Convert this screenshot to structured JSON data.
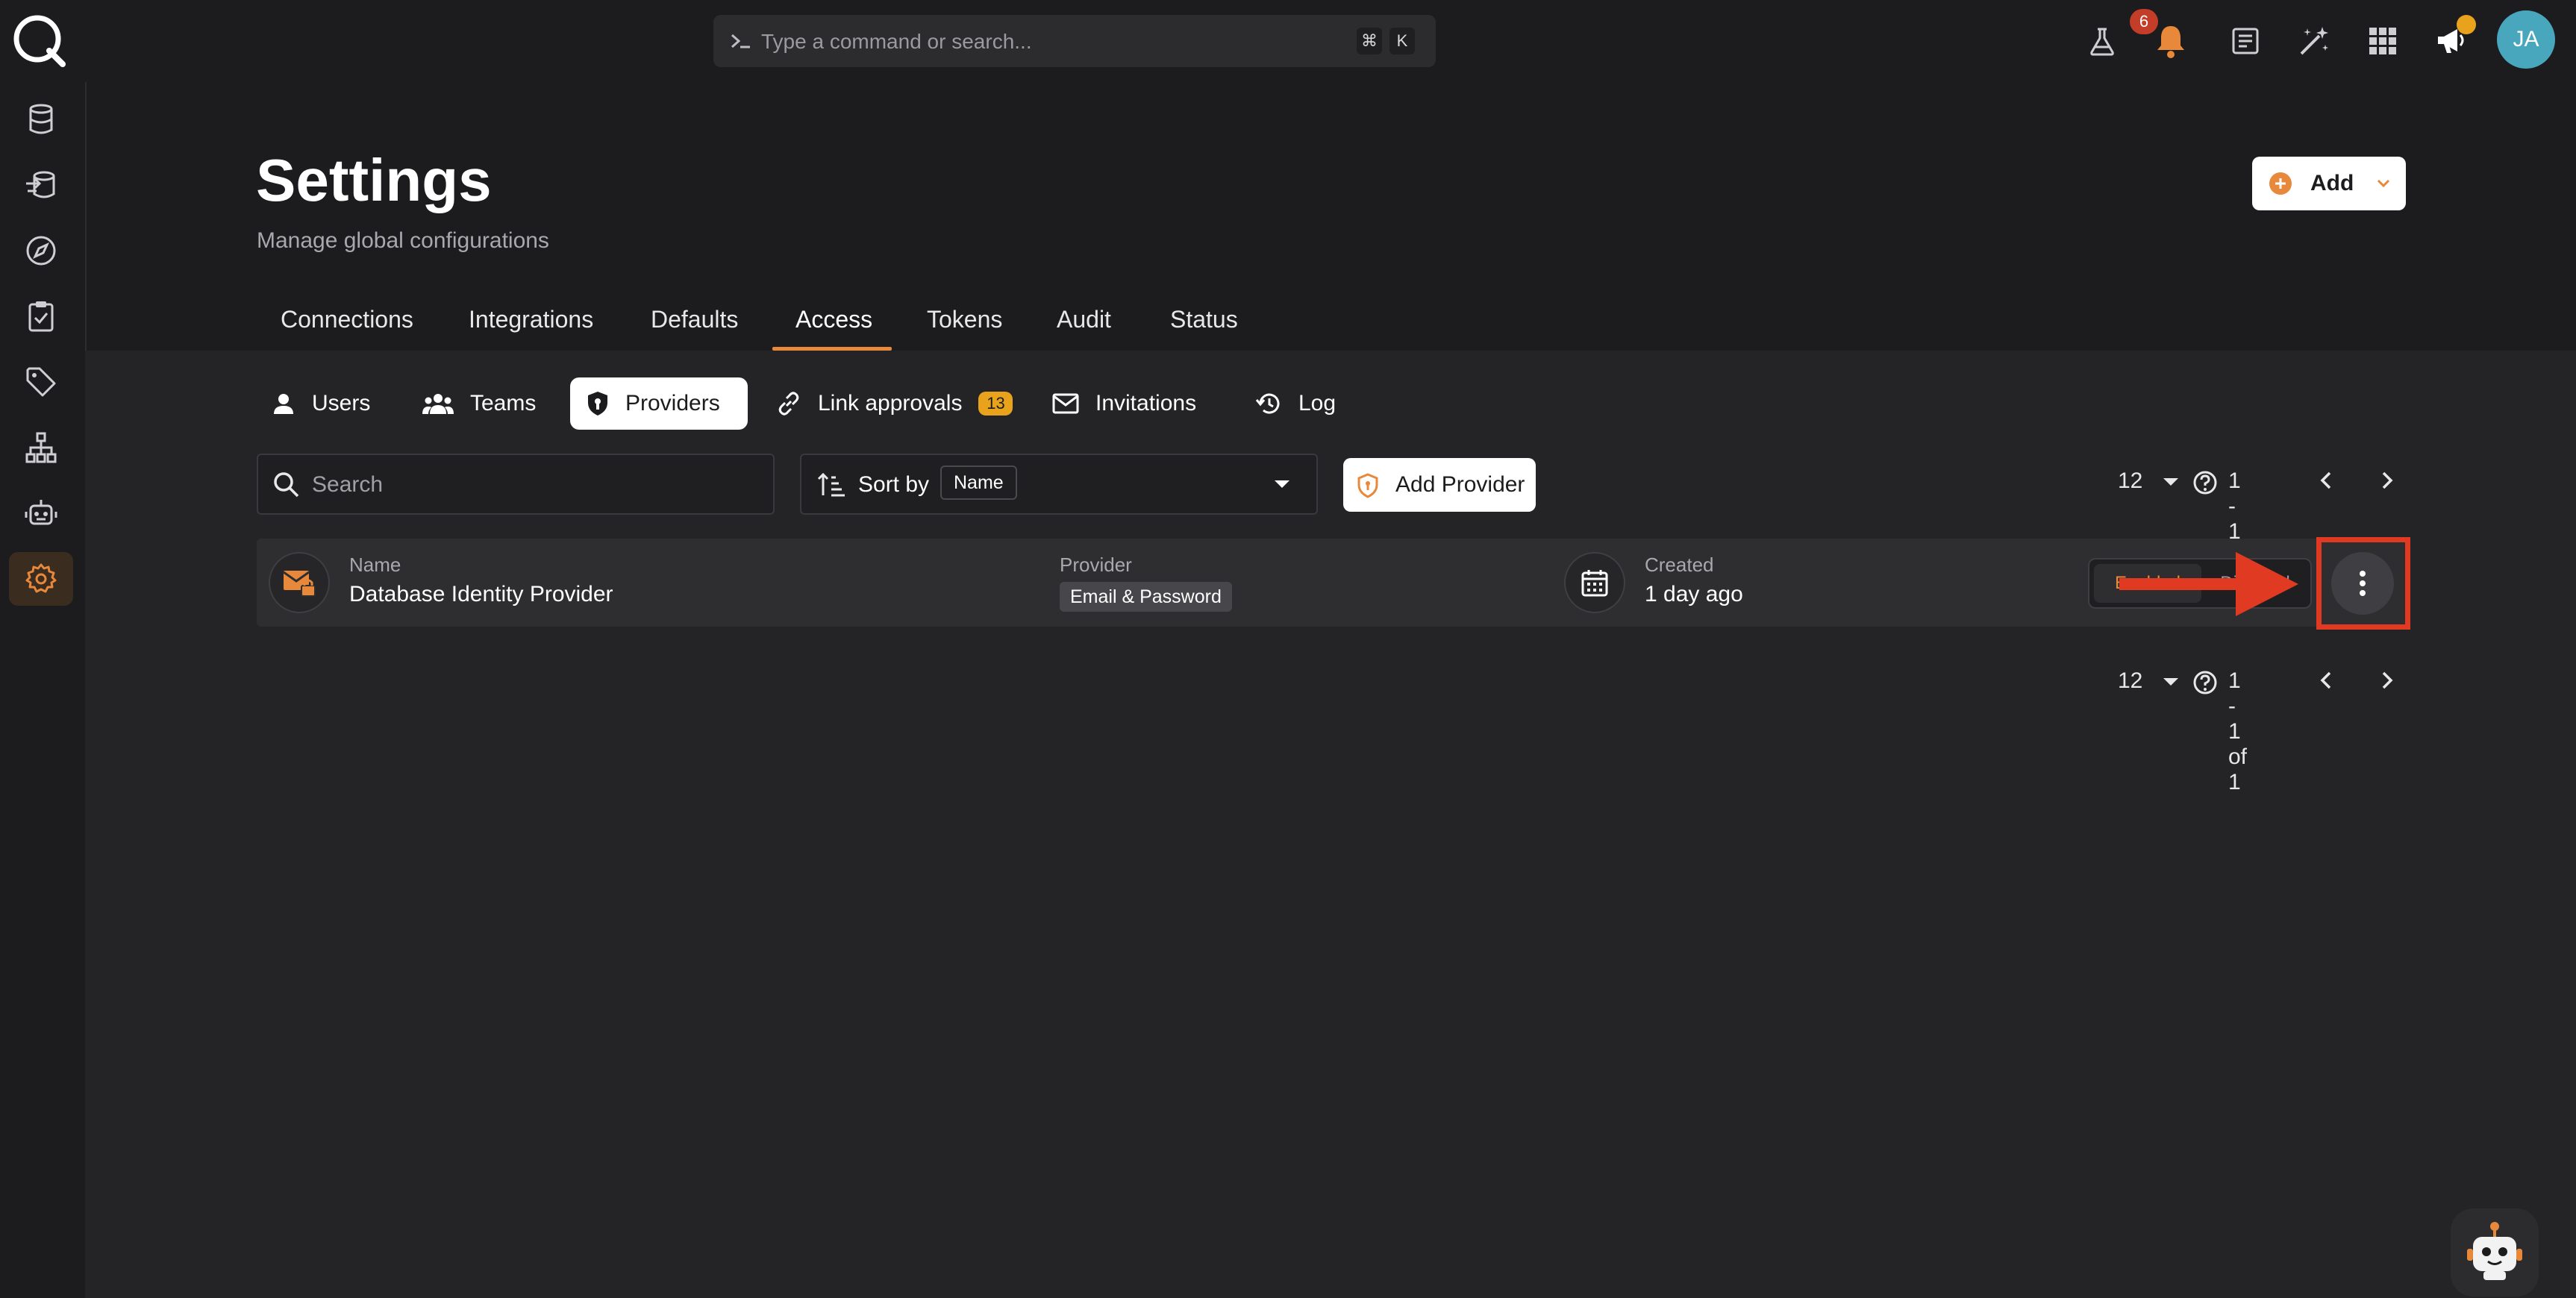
{
  "topbar": {
    "command_placeholder": "Type a command or search...",
    "shortcut_keys": [
      "⌘",
      "K"
    ],
    "notification_count": "6",
    "user_initials": "JA",
    "icons": [
      "flask-icon",
      "bell-icon",
      "document-icon",
      "sparkle-icon",
      "apps-grid-icon",
      "megaphone-icon"
    ]
  },
  "sidebar": {
    "items": [
      "database",
      "ingest",
      "explore",
      "quality",
      "tags",
      "hierarchy",
      "bot",
      "settings"
    ],
    "active": "settings"
  },
  "header": {
    "title": "Settings",
    "subtitle": "Manage global configurations",
    "add_label": "Add"
  },
  "main_tabs": {
    "items": [
      "Connections",
      "Integrations",
      "Defaults",
      "Access",
      "Tokens",
      "Audit",
      "Status"
    ],
    "active": "Access"
  },
  "sub_tabs": {
    "items": [
      "Users",
      "Teams",
      "Providers",
      "Link approvals",
      "Invitations",
      "Log"
    ],
    "active": "Providers",
    "link_approvals_count": "13"
  },
  "toolbar": {
    "search_placeholder": "Search",
    "sort_label": "Sort by",
    "sort_value": "Name",
    "add_provider_label": "Add Provider"
  },
  "pagination": {
    "page_size": "12",
    "range_text": "1 - 1 of 1"
  },
  "providers": [
    {
      "name_label": "Name",
      "name": "Database Identity Provider",
      "provider_label": "Provider",
      "provider": "Email & Password",
      "created_label": "Created",
      "created": "1 day ago",
      "toggle_on": "Enabled",
      "toggle_off": "Disabled"
    }
  ],
  "colors": {
    "accent": "#e8883a",
    "badge": "#e8a21c",
    "notification": "#c43d28",
    "annotation": "#e03a22",
    "avatar": "#48a6bd"
  }
}
